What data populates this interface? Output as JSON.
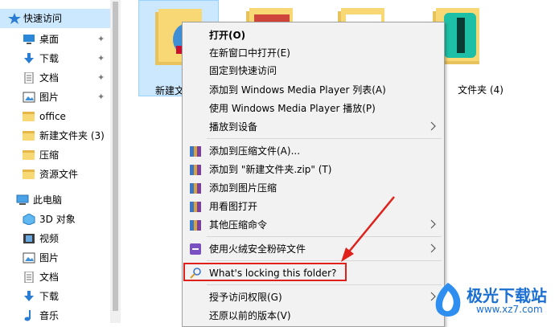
{
  "sidebar": {
    "items": [
      {
        "label": "快速访问",
        "icon": "star-icon"
      },
      {
        "label": "桌面",
        "icon": "desktop-icon"
      },
      {
        "label": "下载",
        "icon": "download-icon"
      },
      {
        "label": "文档",
        "icon": "document-icon"
      },
      {
        "label": "图片",
        "icon": "picture-icon"
      },
      {
        "label": "office",
        "icon": "folder-icon"
      },
      {
        "label": "新建文件夹 (3)",
        "icon": "folder-icon"
      },
      {
        "label": "压缩",
        "icon": "folder-icon"
      },
      {
        "label": "资源文件",
        "icon": "folder-icon"
      },
      {
        "label": "此电脑",
        "icon": "computer-icon"
      },
      {
        "label": "3D 对象",
        "icon": "3d-objects-icon"
      },
      {
        "label": "视频",
        "icon": "video-icon"
      },
      {
        "label": "图片",
        "icon": "picture-icon"
      },
      {
        "label": "文档",
        "icon": "document-icon"
      },
      {
        "label": "下载",
        "icon": "download-icon"
      },
      {
        "label": "音乐",
        "icon": "music-icon"
      }
    ],
    "pin_icon": "pin-icon"
  },
  "files": [
    {
      "name": "新建文"
    },
    {
      "name": ""
    },
    {
      "name": ""
    },
    {
      "name": "文件夹 (4)"
    }
  ],
  "context_menu": {
    "items": [
      {
        "label": "打开(O)",
        "bold": true
      },
      {
        "label": "在新窗口中打开(E)"
      },
      {
        "label": "固定到快速访问"
      },
      {
        "label": "添加到 Windows Media Player 列表(A)"
      },
      {
        "label": "使用 Windows Media Player 播放(P)"
      },
      {
        "label": "播放到设备",
        "submenu": true
      },
      {
        "label": "添加到压缩文件(A)...",
        "icon": "winrar-icon"
      },
      {
        "label": "添加到 \"新建文件夹.zip\" (T)",
        "icon": "winrar-icon"
      },
      {
        "label": "添加到图片压缩",
        "icon": "winrar-icon"
      },
      {
        "label": "用看图打开",
        "icon": "winrar-icon"
      },
      {
        "label": "其他压缩命令",
        "icon": "winrar-icon",
        "submenu": true
      },
      {
        "label": "使用火绒安全粉碎文件",
        "icon": "huorong-icon",
        "submenu": true
      },
      {
        "label": "What's locking this folder?",
        "icon": "lock-search-icon"
      },
      {
        "label": "授予访问权限(G)",
        "submenu": true
      },
      {
        "label": "还原以前的版本(V)"
      }
    ]
  },
  "watermark": {
    "title": "极光下载站",
    "url": "www.xz7.com"
  },
  "colors": {
    "selection": "#cce8ff",
    "highlight_border": "#e0211b",
    "folder": "#f8d775"
  }
}
